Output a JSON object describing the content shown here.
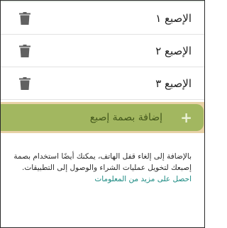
{
  "fingerprints": [
    {
      "label": "الإصبع ١",
      "delete_icon": "trash-icon"
    },
    {
      "label": "الإصبع ٢",
      "delete_icon": "trash-icon"
    },
    {
      "label": "الإصبع ٣",
      "delete_icon": "trash-icon"
    }
  ],
  "add_button": {
    "icon": "+",
    "label": "إضافة بصمة إصبع"
  },
  "info": {
    "text": "بالإضافة إلى إلغاء قفل الهاتف، يمكنك أيضًا استخدام بصمة إصبعك لتخويل عمليات الشراء والوصول إلى التطبيقات.",
    "link": "احصل على مزيد من المعلومات"
  },
  "colors": {
    "accent_green": "#a2b760",
    "highlight": "#e8d1a6",
    "link": "#1b8a82",
    "icon_gray": "#616161"
  }
}
